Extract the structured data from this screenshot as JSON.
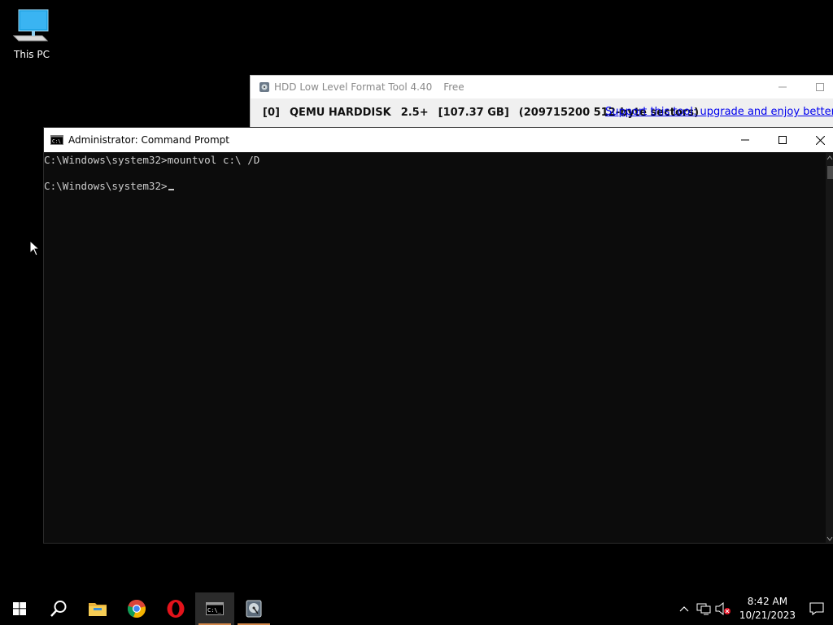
{
  "desktop": {
    "icons": [
      {
        "label": "This PC",
        "icon": "this-pc-icon"
      }
    ]
  },
  "hdd_tool": {
    "title": "HDD Low Level Format Tool 4.40",
    "edition": "Free",
    "drive": {
      "index": "[0]",
      "model": "QEMU HARDDISK",
      "revision": "2.5+",
      "size": "[107.37 GB]",
      "sectors": "(209715200 512-byte sectors)"
    },
    "support_link": "Support this tool: upgrade and enjoy better sp"
  },
  "cmd": {
    "title": "Administrator: Command Prompt",
    "lines": [
      "C:\\Windows\\system32>mountvol c:\\ /D",
      "",
      "C:\\Windows\\system32>"
    ]
  },
  "taskbar": {
    "apps": [
      {
        "name": "start-button",
        "icon": "windows-logo-icon"
      },
      {
        "name": "search-button",
        "icon": "search-icon"
      },
      {
        "name": "file-explorer-button",
        "icon": "folder-icon"
      },
      {
        "name": "chrome-button",
        "icon": "chrome-icon"
      },
      {
        "name": "opera-button",
        "icon": "opera-icon"
      },
      {
        "name": "cmd-taskbar-button",
        "icon": "cmd-icon",
        "active": true
      },
      {
        "name": "hdd-tool-taskbar-button",
        "icon": "hdd-icon"
      }
    ],
    "clock": {
      "time": "8:42 AM",
      "date": "10/21/2023"
    }
  },
  "colors": {
    "accent_underline": "#d1874a",
    "link": "#0000ee",
    "console_text": "#cccccc"
  }
}
